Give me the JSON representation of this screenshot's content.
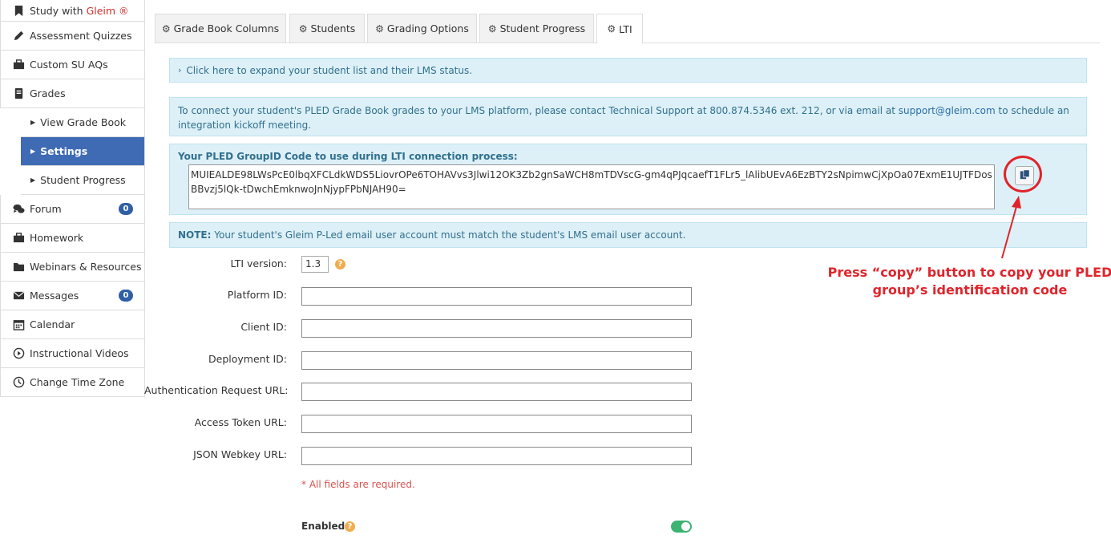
{
  "sidebar": {
    "study_prefix": "Study with ",
    "study_brand": "Gleim ®",
    "items": {
      "assessment_quizzes": "Assessment Quizzes",
      "custom_su_aqs": "Custom SU AQs",
      "grades": "Grades",
      "view_grade_book": "View Grade Book",
      "settings": "Settings",
      "student_progress": "Student Progress",
      "forum": "Forum",
      "forum_badge": "0",
      "homework": "Homework",
      "webinars": "Webinars & Resources",
      "messages": "Messages",
      "messages_badge": "0",
      "calendar": "Calendar",
      "instructional_videos": "Instructional Videos",
      "change_time_zone": "Change Time Zone"
    }
  },
  "tabs": {
    "grade_book_columns": "Grade Book Columns",
    "students": "Students",
    "grading_options": "Grading Options",
    "student_progress": "Student Progress",
    "lti": "LTI"
  },
  "panels": {
    "expand": "Click here to expand your student list and their LMS status.",
    "connect_before": "To connect your student's PLED Grade Book grades to your LMS platform, please contact Technical Support at 800.874.5346 ext. 212, or via email at ",
    "connect_email": "support@gleim.com",
    "connect_after": " to schedule an integration kickoff meeting.",
    "group_title": "Your PLED GroupID Code to use during LTI connection process:",
    "group_code": "MUIEALDE98LWsPcE0lbqXFCLdkWDS5LiovrOPe6TOHAVvs3Jlwi12OK3Zb2gnSaWCH8mTDVscG-gm4qPJqcaefT1FLr5_lAlibUEvA6EzBTY2sNpimwCjXpOa07ExmE1UJTFDosBBvzj5lQk-tDwchEmknwoJnNjypFPbNJAH90=",
    "note_label": "NOTE:",
    "note_text": " Your student's Gleim P-Led email user account must match the student's LMS email user account."
  },
  "annotation": {
    "line1": "Press “copy” button to copy your PLED",
    "line2": "group’s identification code",
    "color": "#e0242b"
  },
  "form": {
    "lti_version_label": "LTI version:",
    "lti_version_value": "1.3",
    "platform_id_label": "Platform ID:",
    "client_id_label": "Client ID:",
    "deployment_id_label": "Deployment ID:",
    "auth_request_url_label": "Authentication Request URL:",
    "access_token_url_label": "Access Token URL:",
    "json_webkey_url_label": "JSON Webkey URL:",
    "required_note": "* All fields are required.",
    "enabled_label": "Enabled",
    "help_glyph": "?",
    "enabled": true
  },
  "colors": {
    "active_nav": "#3f6bb5",
    "badge": "#2f5fa6",
    "panel_bg": "#ddf0f7",
    "panel_text": "#31708f",
    "toggle_on": "#3cb371"
  }
}
